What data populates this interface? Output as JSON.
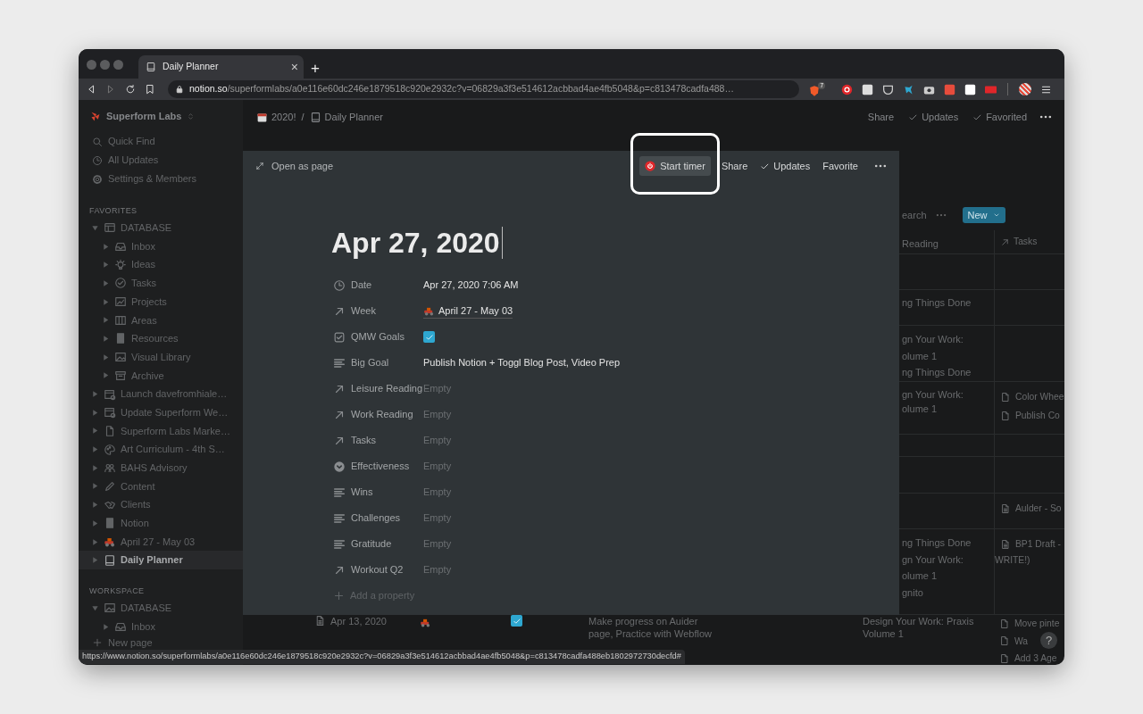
{
  "browser": {
    "tab": {
      "title": "Daily Planner",
      "close": "×"
    },
    "new_tab": "+",
    "address": {
      "host": "notion.so",
      "path": "/superformlabs/a0e116e60dc246e1879518c920e2932c?v=06829a3f3e514612acbbad4ae4fb5048&p=c813478cadfa488…"
    },
    "shield_badge": "7",
    "status_url": "https://www.notion.so/superformlabs/a0e116e60dc246e1879518c920e2932c?v=06829a3f3e514612acbbad4ae4fb5048&p=c813478cadfa488eb1802972730decfd#"
  },
  "sidebar": {
    "workspace": "Superform Labs",
    "actions": [
      "Quick Find",
      "All Updates",
      "Settings & Members"
    ],
    "sections": [
      {
        "title": "FAVORITES",
        "items": [
          {
            "label": "DATABASE",
            "expanded": true,
            "selected": false,
            "children": [
              {
                "label": "Inbox",
                "expanded": false,
                "selected": false
              },
              {
                "label": "Ideas",
                "expanded": false,
                "selected": false
              },
              {
                "label": "Tasks",
                "expanded": false,
                "selected": false
              },
              {
                "label": "Projects",
                "expanded": false,
                "selected": false
              },
              {
                "label": "Areas",
                "expanded": false,
                "selected": false
              },
              {
                "label": "Resources",
                "expanded": false,
                "selected": false
              },
              {
                "label": "Visual Library",
                "expanded": false,
                "selected": false
              },
              {
                "label": "Archive",
                "expanded": false,
                "selected": false
              }
            ]
          },
          {
            "label": "Launch davefromhiale…",
            "expanded": false,
            "selected": false
          },
          {
            "label": "Update Superform We…",
            "expanded": false,
            "selected": false
          },
          {
            "label": "Superform Labs Marke…",
            "expanded": false,
            "selected": false
          },
          {
            "label": "Art Curriculum - 4th S…",
            "expanded": false,
            "selected": false
          },
          {
            "label": "BAHS Advisory",
            "expanded": false,
            "selected": false
          },
          {
            "label": "Content",
            "expanded": false,
            "selected": false
          },
          {
            "label": "Clients",
            "expanded": false,
            "selected": false
          },
          {
            "label": "Notion",
            "expanded": false,
            "selected": false
          },
          {
            "label": "April 27 - May 03",
            "expanded": false,
            "selected": false
          },
          {
            "label": "Daily Planner",
            "expanded": false,
            "selected": true
          }
        ]
      },
      {
        "title": "WORKSPACE",
        "items": [
          {
            "label": "DATABASE",
            "expanded": true,
            "selected": false,
            "children": [
              {
                "label": "Inbox",
                "expanded": false,
                "selected": false
              }
            ]
          }
        ]
      }
    ],
    "new_page": "New page"
  },
  "topbar": {
    "breadcrumbs": [
      "2020!",
      "Daily Planner"
    ],
    "separator": "/",
    "actions": [
      {
        "label": "Share",
        "kind": "text"
      },
      {
        "label": "Updates",
        "kind": "check"
      },
      {
        "label": "Favorited",
        "kind": "check"
      },
      {
        "kind": "more"
      }
    ]
  },
  "modal": {
    "open_as_page": "Open as page",
    "actions": [
      {
        "label": "Start timer",
        "kind": "timer"
      },
      {
        "label": "Share",
        "kind": "text"
      },
      {
        "label": "Updates",
        "kind": "check"
      },
      {
        "label": "Favorite",
        "kind": "text"
      },
      {
        "kind": "more"
      }
    ],
    "title": "Apr 27, 2020",
    "properties": [
      {
        "label": "Date",
        "kind": "text",
        "value": "Apr 27, 2020 7:06 AM"
      },
      {
        "label": "Week",
        "kind": "page_link",
        "value": "April 27 - May 03"
      },
      {
        "label": "QMW Goals",
        "kind": "checkbox",
        "checked": true
      },
      {
        "label": "Big Goal",
        "kind": "text",
        "value": "Publish Notion + Toggl Blog Post, Video Prep"
      },
      {
        "label": "Leisure Reading",
        "kind": "empty",
        "value": "Empty"
      },
      {
        "label": "Work Reading",
        "kind": "empty",
        "value": "Empty"
      },
      {
        "label": "Tasks",
        "kind": "empty",
        "value": "Empty"
      },
      {
        "label": "Effectiveness",
        "kind": "empty",
        "value": "Empty"
      },
      {
        "label": "Wins",
        "kind": "empty",
        "value": "Empty"
      },
      {
        "label": "Challenges",
        "kind": "empty",
        "value": "Empty"
      },
      {
        "label": "Gratitude",
        "kind": "empty",
        "value": "Empty"
      },
      {
        "label": "Workout Q2",
        "kind": "empty",
        "value": "Empty"
      }
    ],
    "add_property": "Add a property"
  },
  "background_table": {
    "search": "earch",
    "new_button": "New",
    "columns": [
      "Reading",
      "Tasks"
    ],
    "rows": [
      {},
      {
        "reading": [
          "ng Things Done"
        ]
      },
      {
        "reading": [
          "gn Your Work:",
          "olume 1",
          "ng Things Done"
        ]
      },
      {
        "reading": [
          "gn Your Work:",
          "olume 1"
        ],
        "tasks": [
          "Color Whee",
          "Publish Co"
        ]
      },
      {},
      {},
      {
        "tasks": [
          "Aulder - So"
        ]
      },
      {
        "reading": [
          "ng Things Done",
          "gn Your Work:",
          "olume 1",
          "gnito"
        ],
        "tasks": [
          "BP1 Draft -"
        ],
        "tasks_note": "WRITE!)"
      }
    ],
    "bottom_row": {
      "date": "Apr 13, 2020",
      "checked": true,
      "summary": "Make progress on Auider page, Practice with Webflow",
      "reading": "Design Your Work: Praxis Volume 1",
      "tasks": [
        "Move pinte",
        "Wa",
        "Add 3 Age"
      ]
    }
  },
  "help_button": "?"
}
